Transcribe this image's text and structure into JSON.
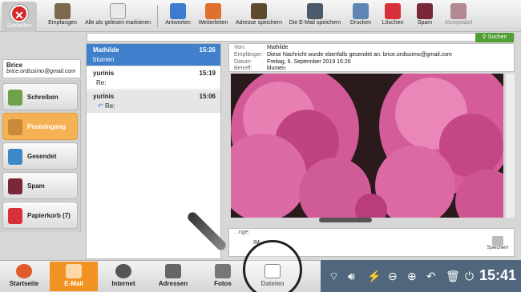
{
  "toolbar": {
    "close_label": "Schließen",
    "buttons": [
      {
        "label": "Empfangen"
      },
      {
        "label": "Alle als gelesen markieren"
      },
      {
        "label": "Antworten"
      },
      {
        "label": "Weiterleiten"
      },
      {
        "label": "Adresse speichern"
      },
      {
        "label": "Die E-Mail speichern"
      },
      {
        "label": "Drucken"
      },
      {
        "label": "Löschen"
      },
      {
        "label": "Spam"
      },
      {
        "label": "Akzeptabel"
      }
    ]
  },
  "search": {
    "button_label": "Suchen",
    "placeholder": ""
  },
  "account": {
    "name": "Brice",
    "email": "brice.ordissimo@gmail.com"
  },
  "folders": [
    {
      "label": "Schreiben"
    },
    {
      "label": "Posteingang"
    },
    {
      "label": "Gesendet"
    },
    {
      "label": "Spam"
    },
    {
      "label": "Papierkorb",
      "count": "(7)"
    }
  ],
  "messages": [
    {
      "from": "Mathilde",
      "time": "15:26",
      "subject": "blumen"
    },
    {
      "from": "yurinis",
      "time": "15:19",
      "subject": "Re:"
    },
    {
      "from": "yurinis",
      "time": "15:06",
      "subject": "Re:"
    }
  ],
  "header": {
    "from_label": "Von:",
    "from": "Mathilde",
    "to_label": "Empfänger:",
    "to": "Diese Nachricht wurde ebenfalls gesendet an: brice.ordissimo@gmail.com",
    "date_label": "Datum:",
    "date": "Freitag, 6. September 2019 15:26",
    "subject_label": "Betreff:",
    "subject": "blumen"
  },
  "attachments": {
    "label": "...nge:",
    "file": "IM...",
    "save_label": "Speichern"
  },
  "bottom_nav": [
    {
      "label": "Startseite"
    },
    {
      "label": "E-Mail"
    },
    {
      "label": "Internet"
    },
    {
      "label": "Adressen"
    },
    {
      "label": "Fotos"
    },
    {
      "label": "Dateien"
    }
  ],
  "clock": "15:41",
  "colors": {
    "accent": "#f29321",
    "selected_row": "#3f7fcb",
    "system_bar": "#4f667c"
  }
}
